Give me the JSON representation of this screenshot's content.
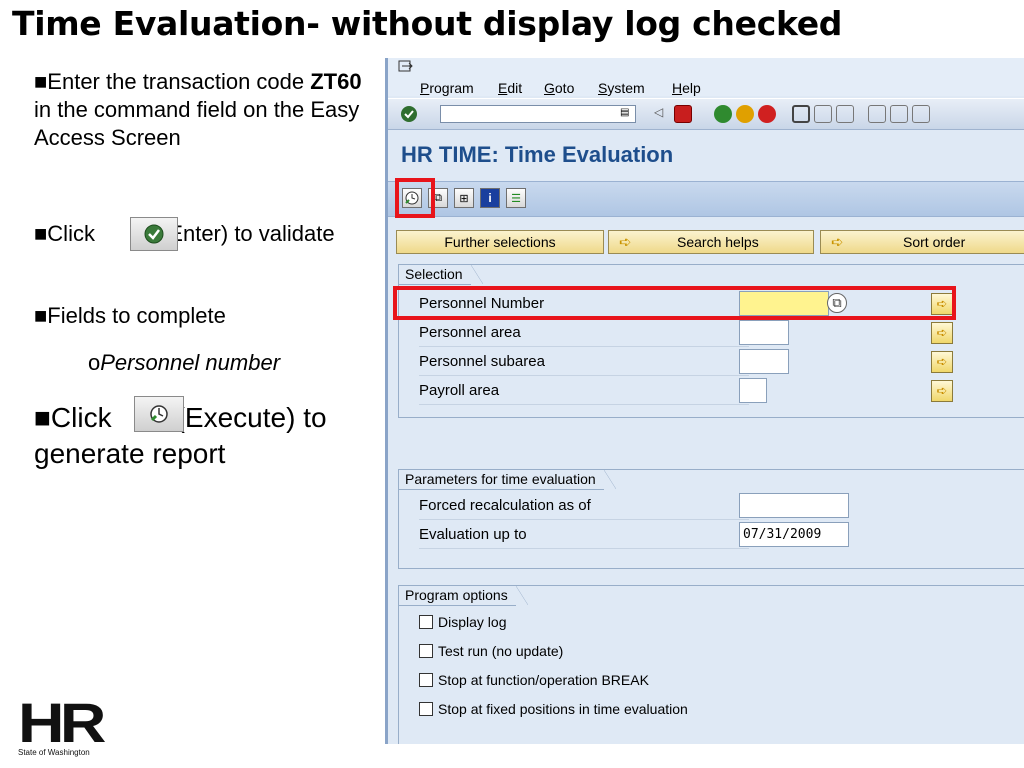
{
  "slide": {
    "title": "Time Evaluation- without display log checked",
    "bullets": {
      "b1_pre": "Enter the transaction code ",
      "b1_code": "ZT60",
      "b1_post": " in the command field on the Easy Access Screen",
      "b2_pre": "Click",
      "b2_post": "(Enter) to validate",
      "b3": "Fields to complete",
      "b3_sub": "Personnel number",
      "b4_pre": "Click",
      "b4_post": "(Execute) to generate report"
    },
    "logo": {
      "text": "HR",
      "subtext": "State of Washington"
    }
  },
  "sap": {
    "menu": [
      "Program",
      "Edit",
      "Goto",
      "System",
      "Help"
    ],
    "screen_title": "HR TIME: Time Evaluation",
    "command_field": {
      "value": ""
    },
    "tabs": {
      "further_selections": "Further selections",
      "search_helps": "Search helps",
      "sort_order": "Sort order"
    },
    "selection": {
      "title": "Selection",
      "fields": [
        {
          "label": "Personnel Number",
          "value": ""
        },
        {
          "label": "Personnel area",
          "value": ""
        },
        {
          "label": "Personnel subarea",
          "value": ""
        },
        {
          "label": "Payroll area",
          "value": ""
        }
      ]
    },
    "parameters": {
      "title": "Parameters for time evaluation",
      "fields": [
        {
          "label": "Forced recalculation as of",
          "value": ""
        },
        {
          "label": "Evaluation up to",
          "value": "07/31/2009"
        }
      ]
    },
    "program_options": {
      "title": "Program options",
      "options": [
        {
          "label": "Display log",
          "checked": false
        },
        {
          "label": "Test run (no update)",
          "checked": false
        },
        {
          "label": "Stop at function/operation BREAK",
          "checked": false
        },
        {
          "label": "Stop at fixed positions in time evaluation",
          "checked": false
        }
      ]
    }
  },
  "colors": {
    "highlight": "#e8141b",
    "sap_title": "#1e4e8c",
    "required_field": "#fff38f"
  }
}
